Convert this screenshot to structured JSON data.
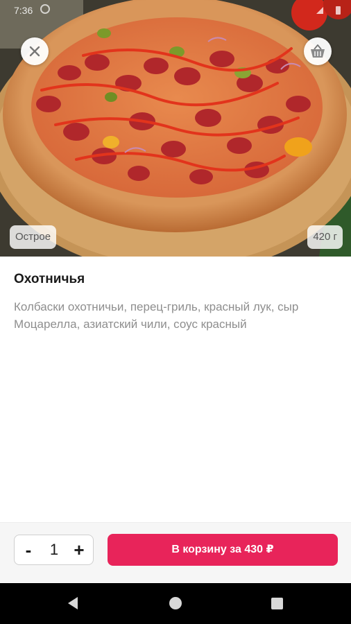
{
  "status_bar": {
    "time": "7:36",
    "icons": [
      "notification-icon",
      "wifi-icon",
      "battery-icon"
    ]
  },
  "hero": {
    "image": "pizza-photo",
    "close_icon": "close-icon",
    "cart_icon": "basket-icon",
    "tag_left": "Острое",
    "tag_right": "420 г"
  },
  "product": {
    "title": "Охотничья",
    "description": "Колбаски охотничьи, перец-гриль, красный лук, сыр Моцарелла, азиатский чили, соус красный"
  },
  "cart_bar": {
    "minus_label": "-",
    "quantity": "1",
    "plus_label": "+",
    "add_button_label": "В корзину за 430 ₽"
  },
  "nav_bar": {
    "back_icon": "back-triangle-icon",
    "home_icon": "home-circle-icon",
    "recents_icon": "recents-square-icon"
  },
  "colors": {
    "accent": "#e8245a",
    "title": "#1a1a1a",
    "description": "#8e8e8e",
    "bottom_bar_bg": "#f6f6f6"
  }
}
